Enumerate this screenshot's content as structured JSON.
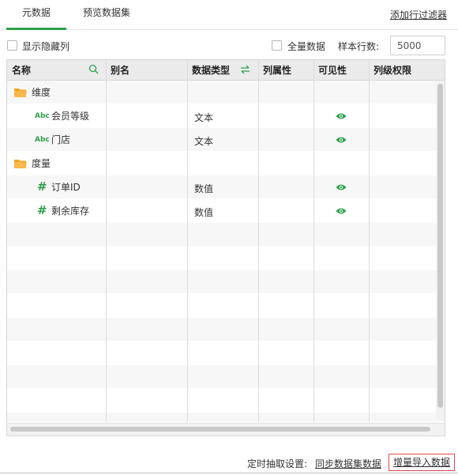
{
  "tabs": [
    {
      "label": "元数据",
      "active": true
    },
    {
      "label": "预览数据集",
      "active": false
    }
  ],
  "toolbar": {
    "add_filter_label": "添加行过滤器",
    "show_hidden_label": "显示隐藏列",
    "all_data_label": "全量数据",
    "sample_rows_label": "样本行数:",
    "sample_rows_value": "5000"
  },
  "table": {
    "columns": [
      "名称",
      "别名",
      "数据类型",
      "列属性",
      "可见性",
      "列级权限"
    ],
    "rows": [
      {
        "kind": "folder",
        "name": "维度",
        "alias": "",
        "type": "",
        "attr": "",
        "visible": false,
        "perm": ""
      },
      {
        "kind": "abc",
        "icon_text": "Abc",
        "name": "会员等级",
        "alias": "",
        "type": "文本",
        "attr": "",
        "visible": true,
        "perm": ""
      },
      {
        "kind": "abc",
        "icon_text": "Abc",
        "name": "门店",
        "alias": "",
        "type": "文本",
        "attr": "",
        "visible": true,
        "perm": ""
      },
      {
        "kind": "folder",
        "name": "度量",
        "alias": "",
        "type": "",
        "attr": "",
        "visible": false,
        "perm": ""
      },
      {
        "kind": "num",
        "icon_text": "#",
        "name": "订单ID",
        "alias": "",
        "type": "数值",
        "attr": "",
        "visible": true,
        "perm": ""
      },
      {
        "kind": "num",
        "icon_text": "#",
        "name": "剩余库存",
        "alias": "",
        "type": "数值",
        "attr": "",
        "visible": true,
        "perm": ""
      }
    ]
  },
  "footer": {
    "schedule_label": "定时抽取设置:",
    "sync_link": "同步数据集数据",
    "incremental_button": "增量导入数据"
  },
  "colors": {
    "accent": "#2e9f4b",
    "folder": "#f5a623",
    "highlight_border": "#e04848"
  },
  "icons": {
    "name_header": "search-icon",
    "type_header": "swap-icon",
    "dimension_folder": "folder-icon",
    "text_field": "abc-icon",
    "numeric_field": "hash-icon",
    "visibility": "eye-icon"
  }
}
